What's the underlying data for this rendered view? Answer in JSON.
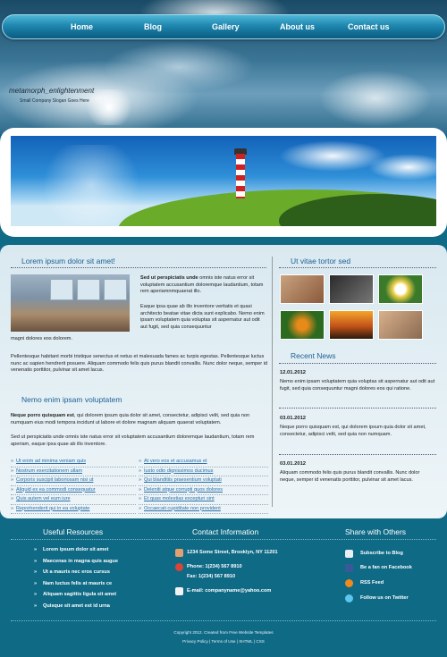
{
  "nav": {
    "items": [
      {
        "label": "Home"
      },
      {
        "label": "Blog"
      },
      {
        "label": "Gallery"
      },
      {
        "label": "About us"
      },
      {
        "label": "Contact us"
      }
    ]
  },
  "brand": {
    "title": "metamorph_enlightenment",
    "slogan": "Small Company Slogan Goes Here"
  },
  "main": {
    "heading1": "Lorem ipsum dolor sit amet!",
    "intro_bold": "Sed ut perspiciatis unde",
    "intro_rest": " omnis iste natus error sit voluptatem accusantium doloremque laudantium, totam rem aperiamnmquaerat illo.",
    "para2": "Eaque ipsa quae ab illo inventore veritatis et quasi architecto beatae vitae dicta sunt explicabo. Nemo enim ipsam voluptatem quia voluptas sit aspernatur aut odit aut fugit, sed quia consequuntur",
    "para2_cont": "magni dolores eos dolorem.",
    "para3": "Pellentesque habitant morbi tristique senectus et netus et malesuada fames ac turpis egestas. Pellentesque luctus nunc ac sapien hendrerit posuere. Aliquam commodo felis quis purus blandit convallis. Nunc dolor neque, semper id venenatis porttitor, pulvinar sit amet lacus.",
    "heading2": "Nemo enim ipsam voluptatem",
    "para4_bold": "Neque porro quisquam est",
    "para4_rest": ", qui dolorem ipsum quia dolor sit amet, consectetur, adipisci velit, sed quia non numquam eius modi tempora incidunt ut labore et dolore magnam aliquam quaerat voluptatem.",
    "para5": "Sed ut perspiciatis unde omnis iste natus error sit voluptatem accusantium doloremque laudantium, totam rem aperiam, eaque ipsa quae ab illo inventore.",
    "links_left": [
      "Ut enim ad minima veniam quis",
      "Nostrum exercitationem ullam",
      "Corporis suscipit laboriosam nisi ut",
      "Aliquid ex ea commodi consequatur",
      "Quis autem vel eum iure",
      "Reprehenderit qui in ea voluptate"
    ],
    "links_right": [
      "At vero eos et accusamus et",
      "Iusto odio dignissimos ducimus",
      "Qui blanditiis praesentium voluptati",
      "Deleniti atque corrupti quos dolores",
      "Et quas molestias excepturi sint",
      "Occaecati cupiditate non provident"
    ]
  },
  "sidebar": {
    "heading": "Ut vitae tortor sed",
    "news_heading": "Recent News",
    "news": [
      {
        "date": "12.01.2012",
        "text": "Nemo enim ipsam voluptatem quia voluptas sit aspernatur aut odit aut fugit, sed quia consequuntur magni dolores eos qui ratione."
      },
      {
        "date": "03.01.2012",
        "text": "Neque porro quisquam est, qui dolorem ipsum quia dolor sit amet, consectetur, adipisci velit, sed quia non numquam."
      },
      {
        "date": "03.01.2012",
        "text": "Aliquam commodo felis quis purus blandit convallis. Nunc dolor neque, semper id venenatis porttitor, pulvinar sit amet lacus."
      }
    ]
  },
  "footer": {
    "resources_heading": "Useful Resources",
    "resources": [
      "Lorem ipsum dolor sit amet",
      "Maecenas in magna quis augue",
      "Ut a mauris nec eros cursus",
      "Nam luctus felis at mauris ce",
      "Aliquam sagittis ligula sit amet",
      "Quisque sit amet est id urna"
    ],
    "contact_heading": "Contact Information",
    "address": "1234 Some Street, Brooklyn, NY 11201",
    "phone": "Phone: 1(234) 567 8910",
    "fax": "Fax: 1(234) 567 8910",
    "email": "E-mail: companyname@yahoo.com",
    "share_heading": "Share with Others",
    "share": [
      "Subscribe to Blog",
      "Be a fan on Facebook",
      "RSS Feed",
      "Follow us on Twitter"
    ],
    "copyright": "Copyright 2012. Created from Free Website Templates",
    "links": "Privacy Policy | Terms of Use | XHTML | CSS"
  },
  "colors": {
    "accent": "#1c5f96",
    "page_bg": "#0f6a86",
    "nav": "#1f87ae"
  }
}
